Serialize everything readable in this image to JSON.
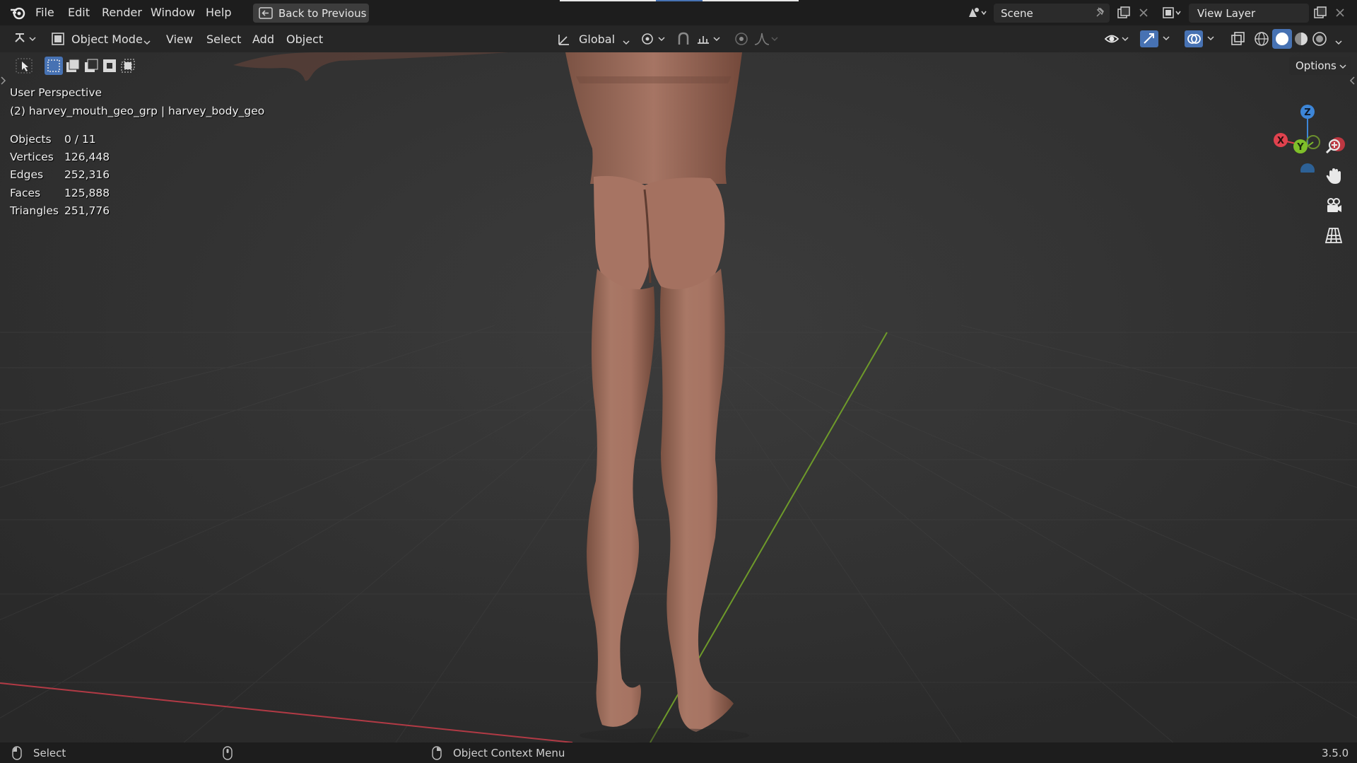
{
  "menu": {
    "file": "File",
    "edit": "Edit",
    "render": "Render",
    "window": "Window",
    "help": "Help",
    "back_to_previous": "Back to Previous"
  },
  "scene": {
    "name": "Scene"
  },
  "view_layer": {
    "name": "View Layer"
  },
  "header": {
    "mode": "Object Mode",
    "view": "View",
    "select": "Select",
    "add": "Add",
    "object": "Object",
    "orientation": "Global",
    "options": "Options"
  },
  "viewport": {
    "perspective": "User Perspective",
    "active_object": "(2) harvey_mouth_geo_grp | harvey_body_geo",
    "stats": [
      {
        "label": "Objects",
        "value": "0 / 11"
      },
      {
        "label": "Vertices",
        "value": "126,448"
      },
      {
        "label": "Edges",
        "value": "252,316"
      },
      {
        "label": "Faces",
        "value": "125,888"
      },
      {
        "label": "Triangles",
        "value": "251,776"
      }
    ],
    "gizmo": {
      "x": "X",
      "y": "Y",
      "z": "Z"
    }
  },
  "statusbar": {
    "select": "Select",
    "context_menu": "Object Context Menu",
    "version": "3.5.0"
  },
  "colors": {
    "x_axis": "#e0424e",
    "y_axis": "#7fbf2a",
    "z_axis": "#3d86d8",
    "skin": "#a87562"
  }
}
